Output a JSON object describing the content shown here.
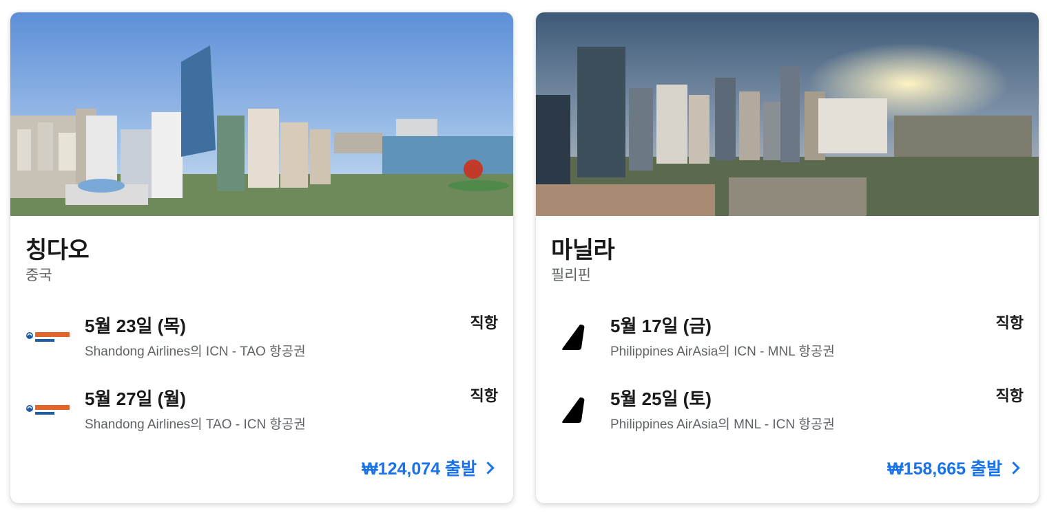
{
  "destinations": [
    {
      "city": "칭다오",
      "country": "중국",
      "price": "₩124,074 출발",
      "flights": [
        {
          "date": "5월 23일 (목)",
          "description": "Shandong Airlines의 ICN - TAO 항공권",
          "type": "직항",
          "airline_logo": "shandong-airlines-logo"
        },
        {
          "date": "5월 27일 (월)",
          "description": "Shandong Airlines의 TAO - ICN 항공권",
          "type": "직항",
          "airline_logo": "shandong-airlines-logo"
        }
      ]
    },
    {
      "city": "마닐라",
      "country": "필리핀",
      "price": "₩158,665 출발",
      "flights": [
        {
          "date": "5월 17일 (금)",
          "description": "Philippines AirAsia의 ICN - MNL 항공권",
          "type": "직항",
          "airline_logo": "airasia-tail-logo"
        },
        {
          "date": "5월 25일 (토)",
          "description": "Philippines AirAsia의 MNL - ICN 항공권",
          "type": "직항",
          "airline_logo": "airasia-tail-logo"
        }
      ]
    }
  ],
  "colors": {
    "price": "#1a73e8",
    "secondary_text": "#5f6368"
  }
}
